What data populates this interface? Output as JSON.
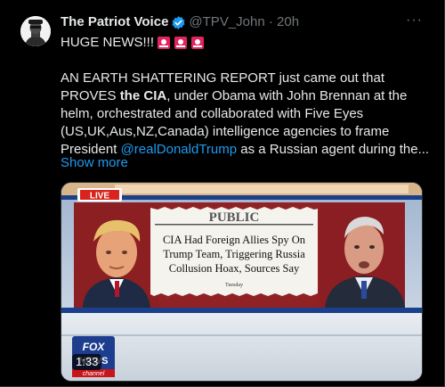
{
  "tweet": {
    "author_name": "The Patriot Voice",
    "handle_time": "@TPV_John · 20h",
    "more_label": "···",
    "headline": "HUGE NEWS!!!",
    "body": {
      "p1": "AN EARTH SHATTERING REPORT just came out that PROVES ",
      "bold": "the CIA",
      "p2": ", under Obama with John Brennan at the helm, orchestrated and collaborated with Five Eyes (US,UK,Aus,NZ,Canada) intelligence agencies to frame President ",
      "mention": "@realDonaldTrump",
      "p3": " as a Russian agent during the..."
    },
    "show_more": "Show more"
  },
  "media": {
    "live_badge": "LIVE",
    "paper_masthead": "PUBLIC",
    "paper_headline": [
      "CIA Had Foreign Allies Spy On",
      "Trump Team, Triggering Russia",
      "Collusion Hoax, Sources Say"
    ],
    "paper_day": "Tuesday",
    "logo_text": [
      "FOX",
      "NEWS",
      "channel"
    ],
    "duration": "1:33"
  },
  "colors": {
    "accent": "#1d9bf0",
    "live_red": "#d9231c",
    "siren_red": "#e0245e"
  }
}
